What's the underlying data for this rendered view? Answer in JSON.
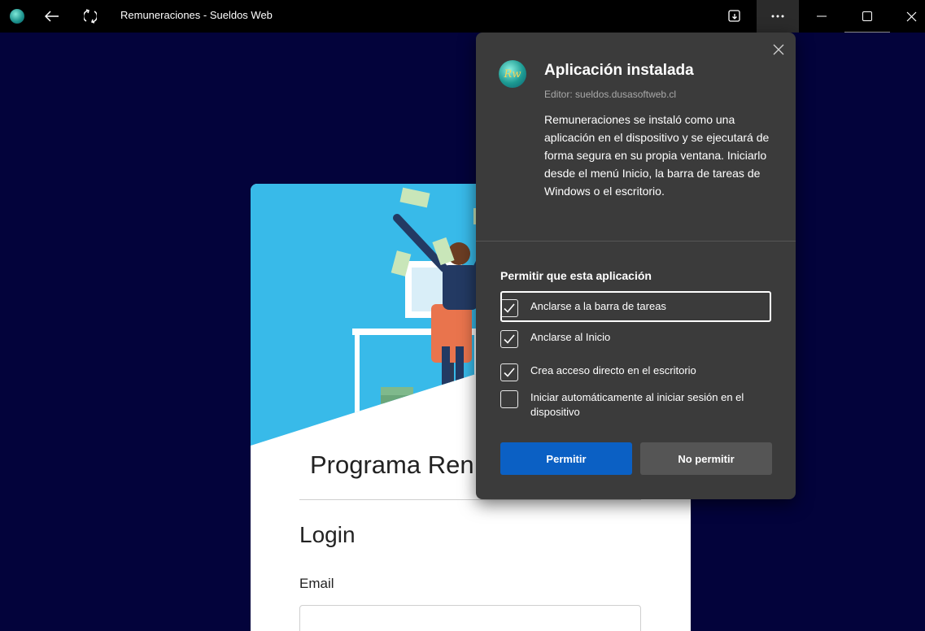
{
  "titlebar": {
    "title": "Remuneraciones - Sueldos Web"
  },
  "card": {
    "title": "Programa Ren",
    "login_title": "Login",
    "email_label": "Email"
  },
  "flyout": {
    "heading": "Aplicación instalada",
    "editor": "Editor: sueldos.dusasoftweb.cl",
    "logo_text": "Rw",
    "description": "Remuneraciones se instaló como una aplicación en el dispositivo y se ejecutará de forma segura en su propia ventana. Iniciarlo desde el menú Inicio, la barra de tareas de Windows o el escritorio.",
    "permissions_heading": "Permitir que esta aplicación",
    "options": [
      {
        "label": "Anclarse a la barra de tareas",
        "checked": true
      },
      {
        "label": "Anclarse al Inicio",
        "checked": true
      },
      {
        "label": "Crea acceso directo en el escritorio",
        "checked": true
      },
      {
        "label": "Iniciar automáticamente al iniciar sesión en el dispositivo",
        "checked": false
      }
    ],
    "allow_label": "Permitir",
    "deny_label": "No permitir"
  },
  "colors": {
    "window_bg": "#03033b",
    "flyout_bg": "#3b3b3b",
    "primary_button": "#0b60c4",
    "secondary_button": "#555555"
  }
}
